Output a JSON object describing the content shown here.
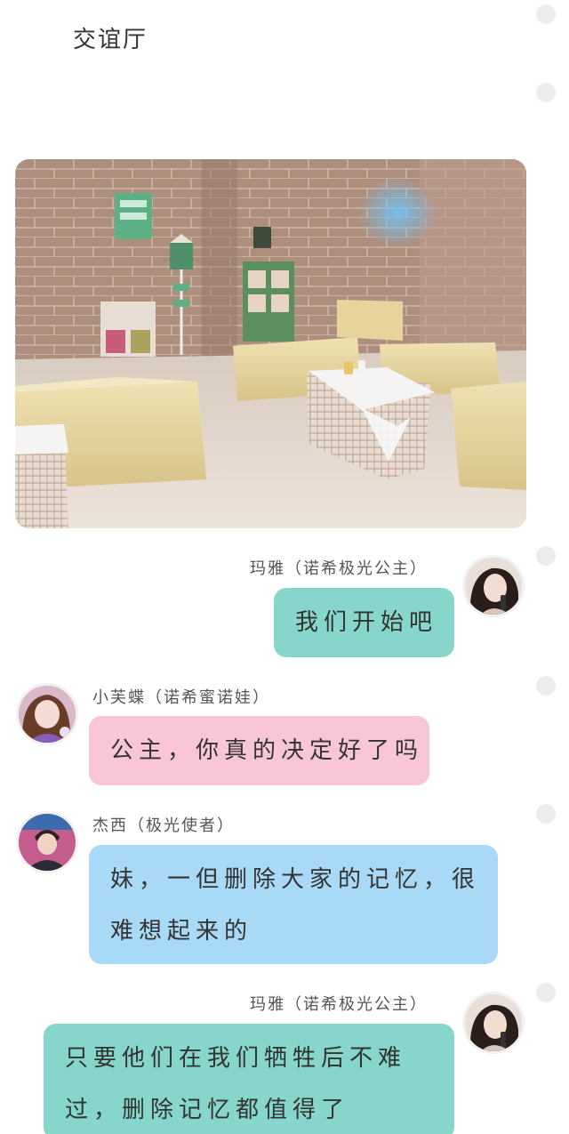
{
  "page": {
    "title": "交谊厅"
  },
  "messages": [
    {
      "sender": "玛雅（诺希极光公主）",
      "side": "right",
      "color": "#86d6cb",
      "avatar": "maya-avatar",
      "lines": [
        "我们开始吧"
      ]
    },
    {
      "sender": "小芙蝶（诺希蜜诺娃）",
      "side": "left",
      "color": "#f8c6d4",
      "avatar": "xiaofudie-avatar",
      "lines": [
        "公主，你真的决定好了吗"
      ]
    },
    {
      "sender": "杰西（极光使者）",
      "side": "left",
      "color": "#a8daf7",
      "avatar": "jiexi-avatar",
      "lines": [
        "妹，一但删除大家的记忆，很",
        "难想起来的"
      ]
    },
    {
      "sender": "玛雅（诺希极光公主）",
      "side": "right",
      "color": "#86d6cb",
      "avatar": "maya-avatar",
      "lines": [
        "只要他们在我们牺牲后不难",
        "过，删除记忆都值得了"
      ]
    }
  ]
}
